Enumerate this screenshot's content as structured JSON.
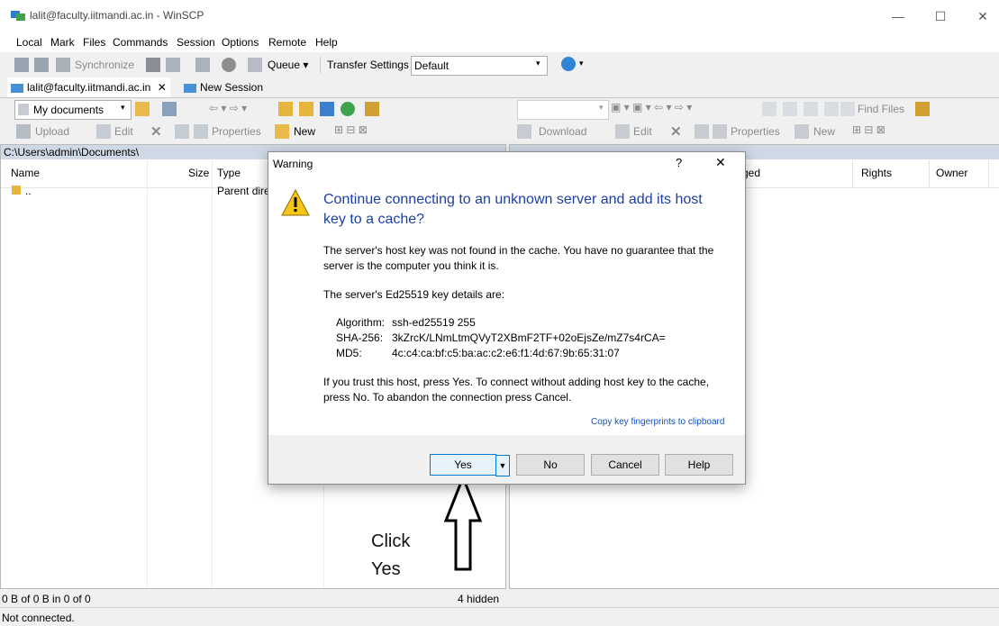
{
  "window": {
    "title": "lalit@faculty.iitmandi.ac.in - WinSCP",
    "min": "—",
    "max": "☐",
    "close": "✕"
  },
  "menu": [
    "Local",
    "Mark",
    "Files",
    "Commands",
    "Session",
    "Options",
    "Remote",
    "Help"
  ],
  "toolbar": {
    "synchronize": "Synchronize",
    "queue": "Queue ▾",
    "transfer_settings": "Transfer Settings",
    "transfer_value": "Default"
  },
  "tabs": {
    "session": "lalit@faculty.iitmandi.ac.in",
    "close": "✕",
    "new_session": "New Session"
  },
  "left": {
    "location": "My documents",
    "upload": "Upload",
    "edit": "Edit",
    "properties": "Properties",
    "new": "New",
    "path": "C:\\Users\\admin\\Documents\\",
    "columns": {
      "name": "Name",
      "size": "Size",
      "type": "Type"
    },
    "rows": [
      {
        "name": "..",
        "type": "Parent dire"
      }
    ],
    "status": "0 B of 0 B in 0 of 0",
    "hidden": "4 hidden"
  },
  "right": {
    "download": "Download",
    "edit": "Edit",
    "properties": "Properties",
    "new": "New",
    "find": "Find Files",
    "columns": {
      "changed": "ged",
      "rights": "Rights",
      "owner": "Owner"
    }
  },
  "bottom_status": "Not connected.",
  "dialog": {
    "title": "Warning",
    "help": "?",
    "close": "✕",
    "heading": "Continue connecting to an unknown server and add its host key to a cache?",
    "p1": "The server's host key was not found in the cache. You have no guarantee that the server is the computer you think it is.",
    "p2": "The server's Ed25519 key details are:",
    "key": {
      "alg_label": "Algorithm:",
      "alg": "ssh-ed25519 255",
      "sha_label": "SHA-256:",
      "sha": "3kZrcK/LNmLtmQVyT2XBmF2TF+02oEjsZe/mZ7s4rCA=",
      "md5_label": "MD5:",
      "md5": "4c:c4:ca:bf:c5:ba:ac:c2:e6:f1:4d:67:9b:65:31:07"
    },
    "p3": "If you trust this host, press Yes. To connect without adding host key to the cache, press No. To abandon the connection press Cancel.",
    "link": "Copy key fingerprints to clipboard",
    "buttons": {
      "yes": "Yes",
      "no": "No",
      "cancel": "Cancel",
      "help": "Help"
    }
  },
  "annotation": {
    "line1": "Click",
    "line2": "Yes"
  }
}
